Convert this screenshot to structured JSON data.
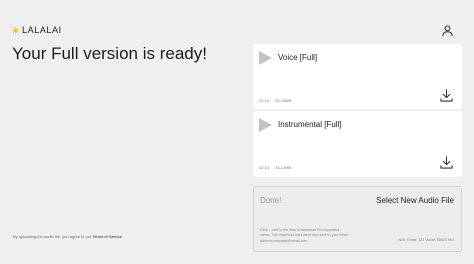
{
  "brand": {
    "name": "LALALAI",
    "logo_icon": "sun-logo-icon",
    "accent_color": "#f3c300"
  },
  "header": {
    "user_icon": "user-icon"
  },
  "headline": "Your Full version is ready!",
  "footer": {
    "terms_prefix": "By uploading the audio file, you agree to our",
    "terms_link": "Terms of Service"
  },
  "tracks": [
    {
      "title": "Voice [Full]",
      "duration": "02:14",
      "size": "33.13MB",
      "play_icon": "play-icon",
      "download_icon": "download-icon"
    },
    {
      "title": "Instrumental [Full]",
      "duration": "02:14",
      "size": "33.12MB",
      "play_icon": "play-icon",
      "download_icon": "download-icon"
    }
  ],
  "status": {
    "done_label": "Done!",
    "new_audio_button": "Select New Audio File",
    "note_line1": "Click ↓ next to the files to download the separated",
    "note_line2": "stems. The download links were also sent to your email",
    "note_line3": "address example@email.com",
    "session_info": "New Times: 123 Vocals 88523 Hist"
  }
}
